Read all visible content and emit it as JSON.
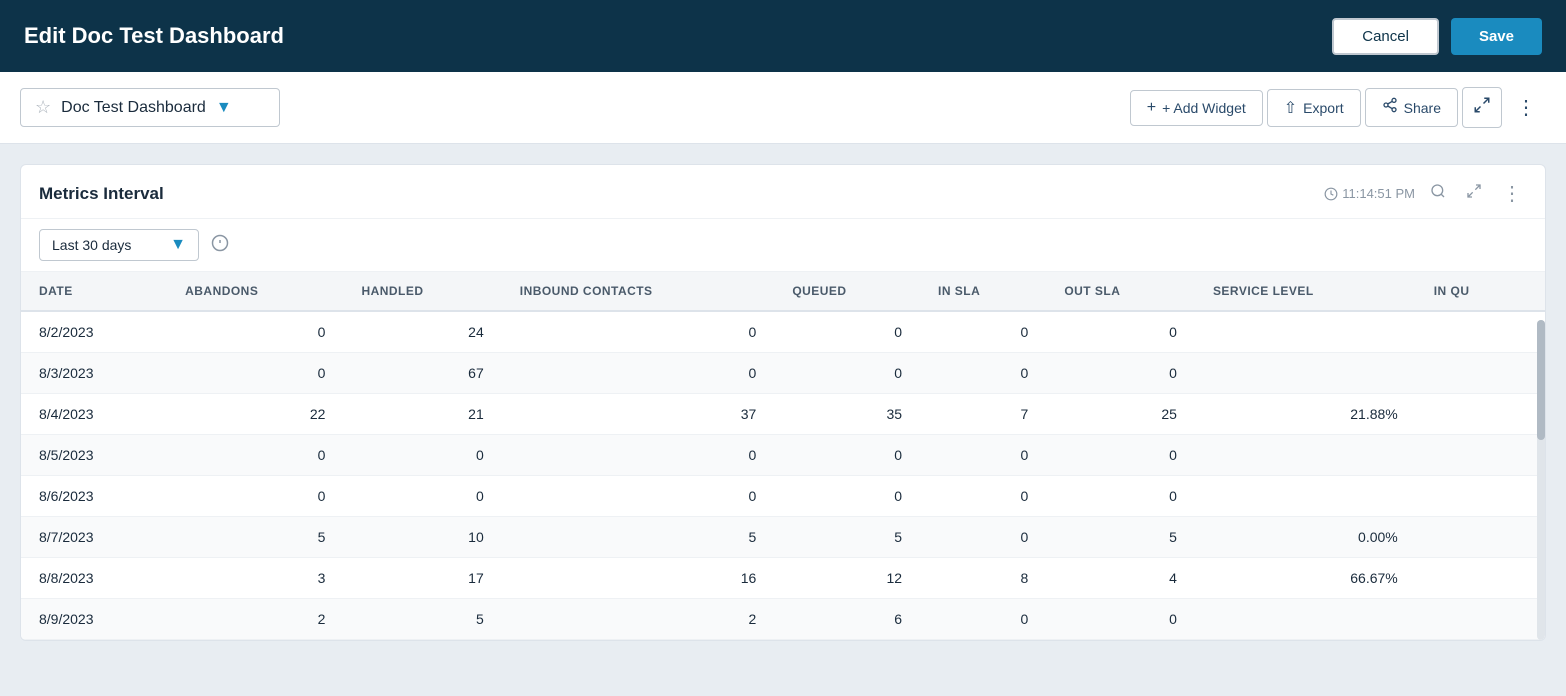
{
  "header": {
    "title": "Edit Doc Test Dashboard",
    "cancel_label": "Cancel",
    "save_label": "Save"
  },
  "subheader": {
    "dashboard_name": "Doc Test Dashboard",
    "add_widget_label": "+ Add Widget",
    "export_label": "Export",
    "share_label": "Share"
  },
  "widget": {
    "title": "Metrics Interval",
    "timestamp": "11:14:51 PM",
    "interval_label": "Last 30 days",
    "info_tooltip": "Information"
  },
  "table": {
    "columns": [
      "DATE",
      "ABANDONS",
      "HANDLED",
      "INBOUND CONTACTS",
      "QUEUED",
      "IN SLA",
      "OUT SLA",
      "SERVICE LEVEL",
      "IN QU"
    ],
    "rows": [
      {
        "date": "8/2/2023",
        "abandons": "0",
        "handled": "24",
        "inbound": "0",
        "queued": "0",
        "in_sla": "0",
        "out_sla": "0",
        "service_level": "",
        "in_qu": ""
      },
      {
        "date": "8/3/2023",
        "abandons": "0",
        "handled": "67",
        "inbound": "0",
        "queued": "0",
        "in_sla": "0",
        "out_sla": "0",
        "service_level": "",
        "in_qu": ""
      },
      {
        "date": "8/4/2023",
        "abandons": "22",
        "handled": "21",
        "inbound": "37",
        "queued": "35",
        "in_sla": "7",
        "out_sla": "25",
        "service_level": "21.88%",
        "in_qu": ""
      },
      {
        "date": "8/5/2023",
        "abandons": "0",
        "handled": "0",
        "inbound": "0",
        "queued": "0",
        "in_sla": "0",
        "out_sla": "0",
        "service_level": "",
        "in_qu": ""
      },
      {
        "date": "8/6/2023",
        "abandons": "0",
        "handled": "0",
        "inbound": "0",
        "queued": "0",
        "in_sla": "0",
        "out_sla": "0",
        "service_level": "",
        "in_qu": ""
      },
      {
        "date": "8/7/2023",
        "abandons": "5",
        "handled": "10",
        "inbound": "5",
        "queued": "5",
        "in_sla": "0",
        "out_sla": "5",
        "service_level": "0.00%",
        "in_qu": ""
      },
      {
        "date": "8/8/2023",
        "abandons": "3",
        "handled": "17",
        "inbound": "16",
        "queued": "12",
        "in_sla": "8",
        "out_sla": "4",
        "service_level": "66.67%",
        "in_qu": ""
      },
      {
        "date": "8/9/2023",
        "abandons": "2",
        "handled": "5",
        "inbound": "2",
        "queued": "6",
        "in_sla": "0",
        "out_sla": "0",
        "service_level": "",
        "in_qu": ""
      }
    ]
  },
  "colors": {
    "header_bg": "#0d3349",
    "header_text": "#ffffff",
    "save_btn_bg": "#1a8bbf",
    "accent": "#1a8bbf"
  }
}
